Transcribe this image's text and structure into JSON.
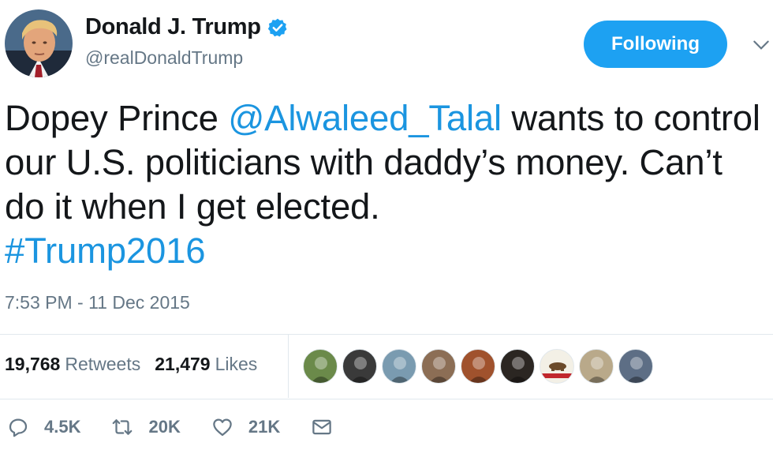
{
  "author": {
    "name": "Donald J. Trump",
    "handle": "@realDonaldTrump",
    "verified": true
  },
  "follow_button": {
    "label": "Following",
    "color": "#1da1f2"
  },
  "tweet": {
    "text_before_mention": "Dopey Prince ",
    "mention": "@Alwaleed_Talal",
    "text_after_mention": " wants to control our U.S. politicians with daddy’s money. Can’t do it when I get elected.",
    "hashtag": "#Trump2016",
    "link_color": "#1b95e0"
  },
  "timestamp": "7:53 PM - 11 Dec 2015",
  "stats": {
    "retweets_count": "19,768",
    "retweets_label": "Retweets",
    "likes_count": "21,479",
    "likes_label": "Likes"
  },
  "liker_avatars": [
    {
      "icon": "avatar-landscape-icon",
      "color": "#6b8a4a"
    },
    {
      "icon": "avatar-animal-icon",
      "color": "#3a3a3a"
    },
    {
      "icon": "avatar-couple-icon",
      "color": "#7a9bb0"
    },
    {
      "icon": "avatar-person-icon",
      "color": "#8c6e55"
    },
    {
      "icon": "avatar-person-icon",
      "color": "#a0522d"
    },
    {
      "icon": "avatar-person-icon",
      "color": "#2b2622"
    },
    {
      "icon": "avatar-california-flag-icon",
      "color": "#e9e6dc"
    },
    {
      "icon": "avatar-group-icon",
      "color": "#b9a98a"
    },
    {
      "icon": "avatar-trump-icon",
      "color": "#5d6e85"
    }
  ],
  "actions": {
    "reply_count": "4.5K",
    "retweet_count": "20K",
    "like_count": "21K"
  }
}
